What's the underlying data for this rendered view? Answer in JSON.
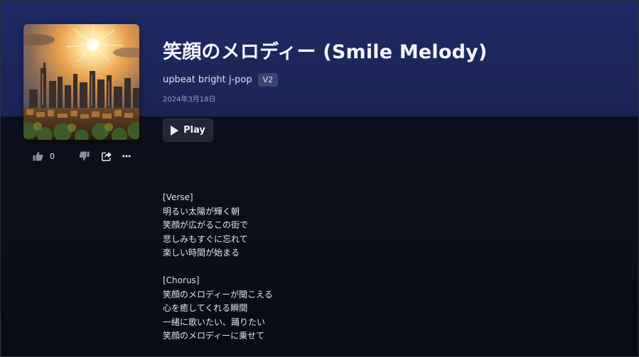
{
  "song": {
    "title": "笑顔のメロディー (Smile Melody)",
    "genre": "upbeat bright j-pop",
    "version": "V2",
    "date": "2024年3月18日",
    "cover_alt": "sunlit city skyline"
  },
  "actions": {
    "play_label": "Play",
    "like_count": "0"
  },
  "lyrics": {
    "verse": [
      "[Verse]",
      "明るい太陽が輝く朝",
      "笑顔が広がるこの街で",
      "悲しみもすぐに忘れて",
      "楽しい時間が始まる"
    ],
    "chorus": [
      "[Chorus]",
      "笑顔のメロディーが聞こえる",
      "心を癒してくれる瞬間",
      "一緒に歌いたい、踊りたい",
      "笑顔のメロディーに乗せて"
    ]
  },
  "colors": {
    "header_band": "#1f2a66",
    "background": "#0b0d16",
    "badge": "#3a4472",
    "play_button": "#222635"
  }
}
